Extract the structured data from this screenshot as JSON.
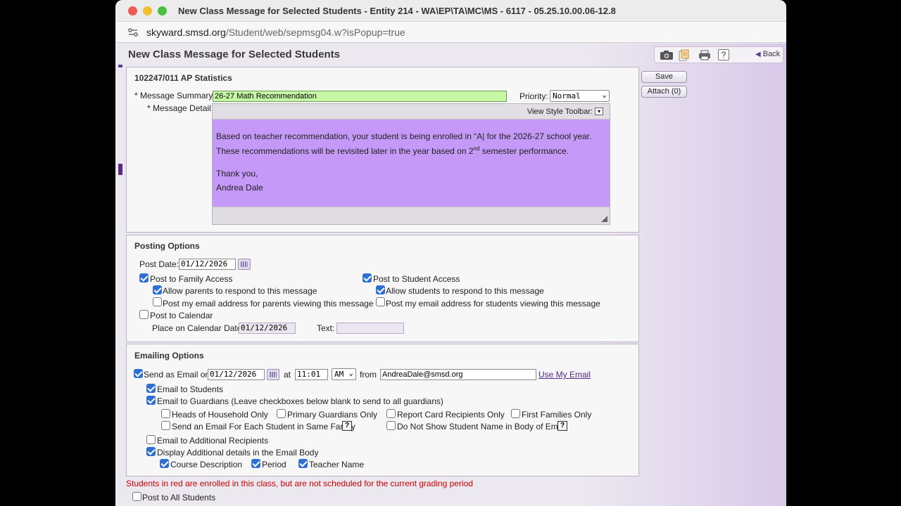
{
  "window": {
    "title": "New Class Message for Selected Students - Entity 214 - WA\\EP\\TA\\MC\\MS - 6117 - 05.25.10.00.06-12.8",
    "url_host": "skyward.smsd.org",
    "url_path": "/Student/web/sepmsg04.w?isPopup=true",
    "colors": {
      "close": "#ee5b55",
      "minimize": "#f3be33",
      "maximize": "#48c03f"
    }
  },
  "header": {
    "title": "New Class Message for Selected Students",
    "toolbar_icons": [
      "camera-icon",
      "notes-icon",
      "print-icon",
      "help-icon"
    ],
    "back_label": "Back"
  },
  "actions": {
    "save_label": "Save",
    "attach_label": "Attach (0)"
  },
  "message": {
    "course": "102247/011 AP Statistics",
    "summary_label": "* Message Summary:",
    "summary_value": "26-27 Math Recommendation",
    "priority_label": "Priority:",
    "priority_value": "Normal",
    "detail_label": "* Message Detail:",
    "toolbar_label": "View Style Toolbar:",
    "body_line1": "Based on teacher recommendation, your student is being enrolled in “A| for the 2026-27 school year.",
    "body_line2a": "These recommendations will be revisited later in the year based on 2",
    "body_line2_sup": "nd",
    "body_line2b": " semester performance.",
    "closing": "Thank you,",
    "signature": "Andrea Dale"
  },
  "posting": {
    "title": "Posting Options",
    "post_date_label": "Post Date:",
    "post_date": "01/12/2026",
    "family_access": "Post to Family Access",
    "allow_parents": "Allow parents to respond to this message",
    "post_email_parents": "Post my email address for parents viewing this message",
    "student_access": "Post to Student Access",
    "allow_students": "Allow students to respond to this message",
    "post_email_students": "Post my email address for students viewing this message",
    "calendar": "Post to Calendar",
    "calendar_date_label": "Place on Calendar Date:",
    "calendar_date": "01/12/2026",
    "text_label": "Text:"
  },
  "emailing": {
    "title": "Emailing Options",
    "send_label": "Send as Email on",
    "send_date": "01/12/2026",
    "at_label": "at",
    "time": "11:01",
    "ampm": "AM",
    "from_label": "from",
    "from_email": "AndreaDale@smsd.org",
    "use_my_email": "Use My Email",
    "email_students": "Email to Students",
    "email_guardians": "Email to Guardians (Leave checkboxes below blank to send to all guardians)",
    "heads_household": "Heads of Household Only",
    "primary_guardians": "Primary Guardians Only",
    "report_card": "Report Card Recipients Only",
    "first_families": "First Families Only",
    "each_student": "Send an Email For Each Student in Same Family",
    "no_student_name": "Do Not Show Student Name in Body of Email",
    "help_glyph": "?",
    "additional_recipients": "Email to Additional Recipients",
    "display_details": "Display Additional details in the Email Body",
    "course_description": "Course Description",
    "period": "Period",
    "teacher_name": "Teacher Name"
  },
  "footer": {
    "notice": "Students in red are enrolled in this class, but are not scheduled for the current grading period",
    "notice_color": "#cc0000",
    "post_all": "Post to All Students"
  }
}
